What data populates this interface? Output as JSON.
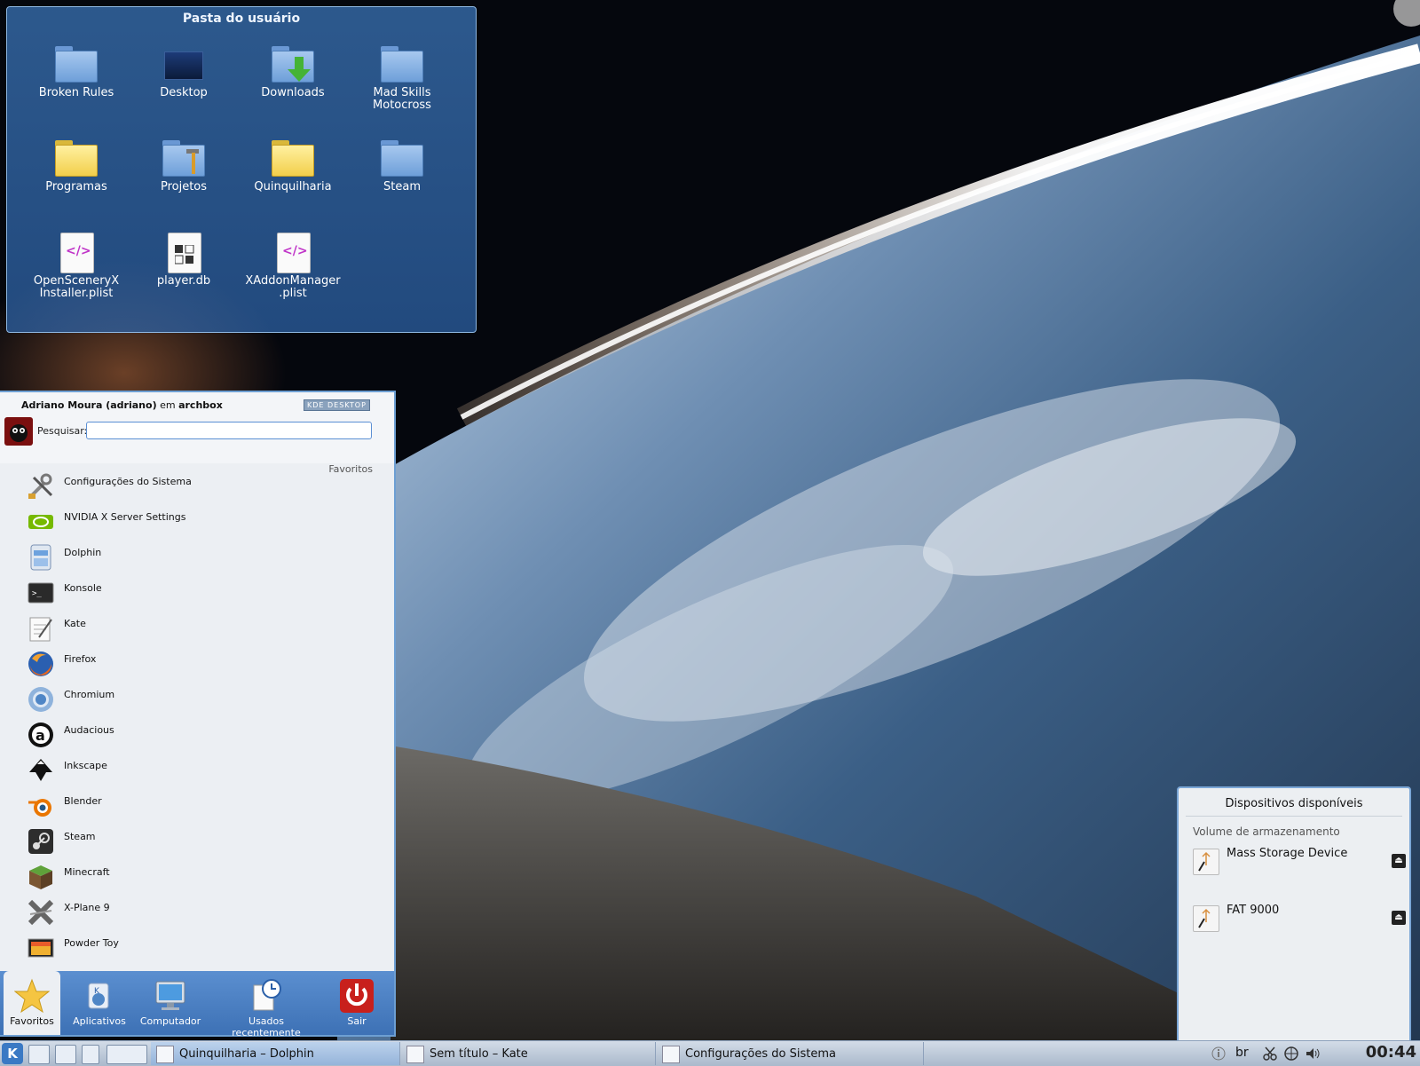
{
  "folder_view": {
    "title": "Pasta do usuário",
    "items": [
      {
        "label": "Broken Rules",
        "icon": "folder-icon"
      },
      {
        "label": "Desktop",
        "icon": "desktop-folder-icon"
      },
      {
        "label": "Downloads",
        "icon": "downloads-folder-icon"
      },
      {
        "label": "Mad Skills Motocross",
        "icon": "folder-icon"
      },
      {
        "label": "Programas",
        "icon": "yellow-folder-icon"
      },
      {
        "label": "Projetos",
        "icon": "projects-folder-icon"
      },
      {
        "label": "Quinquilharia",
        "icon": "yellow-folder-icon"
      },
      {
        "label": "Steam",
        "icon": "folder-icon"
      },
      {
        "label": "OpenSceneryX Installer.plist",
        "icon": "xml-file-icon"
      },
      {
        "label": "player.db",
        "icon": "database-file-icon"
      },
      {
        "label": "XAddonManager .plist",
        "icon": "xml-file-icon"
      }
    ]
  },
  "kickoff": {
    "user_prefix": "Adriano Moura (adriano)",
    "user_mid": " em ",
    "host": "archbox",
    "badge": "KDE DESKTOP",
    "search_label": "Pesquisar:",
    "search_value": "",
    "section": "Favoritos",
    "apps": [
      {
        "label": "Configurações do Sistema",
        "icon": "system-settings-icon"
      },
      {
        "label": "NVIDIA X Server Settings",
        "icon": "nvidia-icon"
      },
      {
        "label": "Dolphin",
        "icon": "dolphin-icon"
      },
      {
        "label": "Konsole",
        "icon": "konsole-icon"
      },
      {
        "label": "Kate",
        "icon": "kate-icon"
      },
      {
        "label": "Firefox",
        "icon": "firefox-icon"
      },
      {
        "label": "Chromium",
        "icon": "chromium-icon"
      },
      {
        "label": "Audacious",
        "icon": "audacious-icon"
      },
      {
        "label": "Inkscape",
        "icon": "inkscape-icon"
      },
      {
        "label": "Blender",
        "icon": "blender-icon"
      },
      {
        "label": "Steam",
        "icon": "steam-icon"
      },
      {
        "label": "Minecraft",
        "icon": "minecraft-icon"
      },
      {
        "label": "X-Plane 9",
        "icon": "xplane-icon"
      },
      {
        "label": "Powder Toy",
        "icon": "powder-toy-icon"
      }
    ],
    "tabs": [
      {
        "label": "Favoritos",
        "icon": "star-icon",
        "active": true
      },
      {
        "label": "Aplicativos",
        "icon": "applications-icon"
      },
      {
        "label": "Computador",
        "icon": "computer-icon"
      },
      {
        "label": "Usados recentemente",
        "icon": "recent-clock-icon"
      },
      {
        "label": "Sair",
        "icon": "power-icon"
      }
    ]
  },
  "devices": {
    "title": "Dispositivos disponíveis",
    "subtitle": "Volume de armazenamento",
    "items": [
      {
        "label": "Mass Storage Device",
        "icon": "usb-drive-icon"
      },
      {
        "label": "FAT 9000",
        "icon": "usb-drive-icon"
      }
    ]
  },
  "taskbar": {
    "kmenu_label": "K",
    "tasks": [
      {
        "label": "Quinquilharia – Dolphin",
        "icon": "dolphin-icon",
        "active": true
      },
      {
        "label": "Sem título – Kate",
        "icon": "kate-icon"
      },
      {
        "label": "Configurações do Sistema",
        "icon": "system-settings-icon"
      }
    ],
    "keyboard_layout": "br",
    "clock": "00:44"
  },
  "colors": {
    "kde_blue": "#3d71b5",
    "panel_bg": "#eceff3"
  }
}
